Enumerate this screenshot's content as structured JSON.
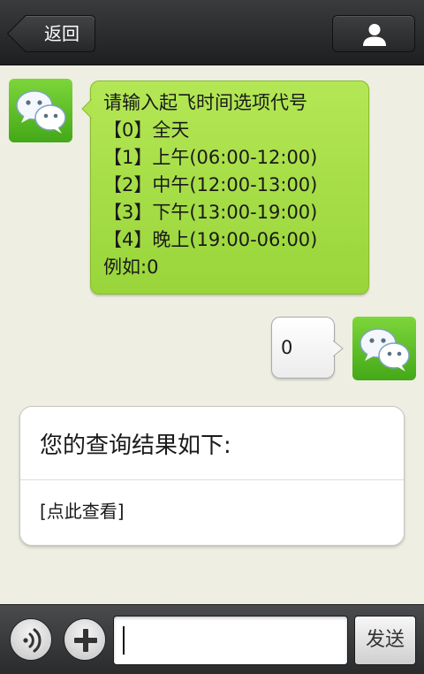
{
  "topbar": {
    "back_label": "返回",
    "profile_icon": "person-icon"
  },
  "messages": [
    {
      "direction": "incoming",
      "avatar_icon": "wechat-logo-icon",
      "bubble_color": "#a8df4a",
      "lines": [
        "请输入起飞时间选项代号",
        "【0】全天",
        "【1】上午(06:00-12:00)",
        "【2】中午(12:00-13:00)",
        "【3】下午(13:00-19:00)",
        "【4】晚上(19:00-06:00)",
        "例如:0"
      ]
    },
    {
      "direction": "outgoing",
      "avatar_icon": "wechat-logo-icon",
      "bubble_color": "#ffffff",
      "text": "0"
    }
  ],
  "result_card": {
    "title": "您的查询结果如下:",
    "link_label": "[点此查看]"
  },
  "input_bar": {
    "voice_icon": "voice-icon",
    "plus_icon": "plus-icon",
    "input_value": "",
    "send_label": "发送"
  },
  "colors": {
    "chat_background": "#efeee2",
    "bar_background": "#2a2b2c",
    "avatar_green": "#5bbf24"
  }
}
